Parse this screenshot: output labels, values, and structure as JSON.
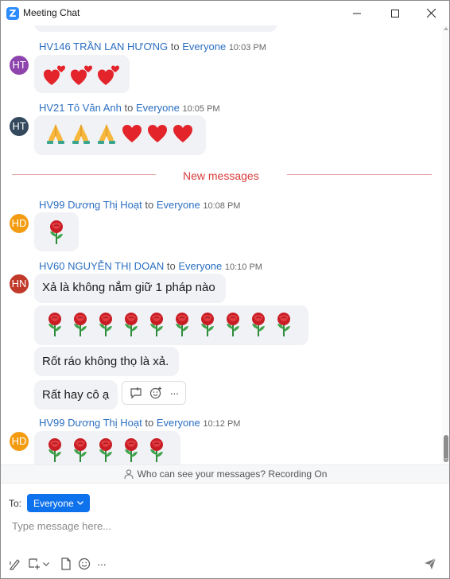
{
  "window": {
    "title": "Meeting Chat",
    "app_icon_letter": "Z"
  },
  "messages": [
    {
      "sender": "HV146 TRẦN LAN HƯƠNG",
      "to": "to",
      "target": "Everyone",
      "time": "10:03 PM",
      "avatar": "HT",
      "avatar_color": "#8e44ad",
      "content": "three heart emojis"
    },
    {
      "sender": "HV21 Tô Văn Anh",
      "to": "to",
      "target": "Everyone",
      "time": "10:05 PM",
      "avatar": "HT",
      "avatar_color": "#34495e",
      "content": "three pray and three red heart emojis"
    },
    {
      "sender": "HV99 Dương Thị Hoạt",
      "to": "to",
      "target": "Everyone",
      "time": "10:08 PM",
      "avatar": "HD",
      "avatar_color": "#f39c12",
      "content": "rose emoji"
    },
    {
      "sender": "HV60 NGUYỄN THỊ DOAN",
      "to": "to",
      "target": "Everyone",
      "time": "10:10 PM",
      "avatar": "HN",
      "avatar_color": "#c0392b",
      "lines": [
        "Xả là không nắm giữ 1 pháp nào",
        "Rốt ráo không thọ là xả.",
        "Rất hay cô ạ"
      ]
    },
    {
      "sender": "HV99 Dương Thị Hoạt",
      "to": "to",
      "target": "Everyone",
      "time": "10:12 PM",
      "avatar": "HD",
      "avatar_color": "#f39c12",
      "content": "five rose emojis"
    }
  ],
  "divider": {
    "label": "New messages"
  },
  "hover_toolbar": {
    "icons": [
      "reply-icon",
      "add-reaction-icon",
      "more-icon"
    ],
    "more_label": "···"
  },
  "visibility": {
    "text": "Who can see your messages? Recording On",
    "icon": "people-icon"
  },
  "composer": {
    "to_label": "To:",
    "to_value": "Everyone",
    "placeholder": "Type message here..."
  },
  "tools": {
    "icons": [
      "format-icon",
      "screenshot-icon",
      "chevron-down-icon",
      "file-icon",
      "emoji-icon",
      "more-icon",
      "send-icon"
    ],
    "more_label": "···"
  },
  "colors": {
    "accent": "#0e72ed",
    "name_blue": "#2b6fc2",
    "new_messages_red": "#d83b3b",
    "bubble_bg": "#f1f2f6"
  }
}
